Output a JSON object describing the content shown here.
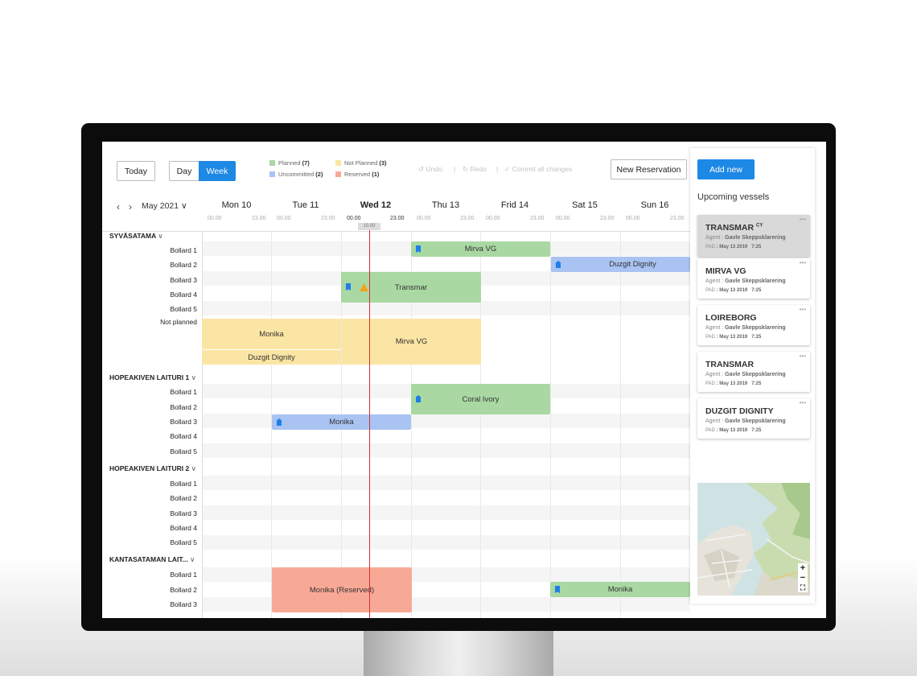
{
  "toolbar": {
    "today": "Today",
    "day": "Day",
    "week": "Week",
    "undo": "Undo",
    "redo": "Redo",
    "commit": "Commit all changes",
    "new_reservation": "New Reservation",
    "sep": "|"
  },
  "legend": [
    {
      "label": "Planned",
      "count": "(7)",
      "color": "#a9d8a3"
    },
    {
      "label": "Not Planned",
      "count": "(3)",
      "color": "#fbe5a4"
    },
    {
      "label": "Uncommitted",
      "count": "(2)",
      "color": "#a9c3f2"
    },
    {
      "label": "Reserved",
      "count": "(1)",
      "color": "#f8a996"
    }
  ],
  "calendar": {
    "month": "May 2021",
    "prev": "‹",
    "next": "›",
    "dropdown": "∨",
    "days": [
      "Mon 10",
      "Tue 11",
      "Wed 12",
      "Thu 13",
      "Frid 14",
      "Sat 15",
      "Sun 16"
    ],
    "tick_start": "00.00",
    "tick_end": "23.00",
    "now_time": "10.00"
  },
  "groups": [
    {
      "name": "SYVÄSATAMA",
      "chevron": "∨"
    },
    {
      "name": "HOPEAKIVEN LAITURI 1",
      "chevron": "∨"
    },
    {
      "name": "HOPEAKIVEN LAITURI 2",
      "chevron": "∨"
    },
    {
      "name": "KANTASATAMAN LAIT...",
      "chevron": "∨"
    }
  ],
  "bollards": [
    "Bollard 1",
    "Bollard 2",
    "Bollard 3",
    "Bollard 4",
    "Bollard 5"
  ],
  "not_planned": "Not planned",
  "bookings": {
    "b1": "Mirva VG",
    "b2": "Duzgit Dignity",
    "b3": "Transmar",
    "b4": "Monika",
    "b5": "Duzgit Dignity",
    "b6": "Mirva VG",
    "b7": "Coral Ivory",
    "b8": "Monika",
    "b9": "Monika (Reserved)",
    "b10": "Monika"
  },
  "sidebar": {
    "add_new": "Add new",
    "title": "Upcoming vessels",
    "vessels": [
      {
        "name": "TRANSMAR",
        "flag": "CY",
        "agent_label": "Agent :",
        "agent": "Gavle Skeppsklarering",
        "pad_label": "PAD",
        "pad": ": May 13 2019",
        "time": "7:25",
        "menu": "•••"
      },
      {
        "name": "MIRVA VG",
        "flag": "",
        "agent_label": "Agent :",
        "agent": "Gavle Skeppsklarering",
        "pad_label": "PAD",
        "pad": ": May 13 2019",
        "time": "7:25",
        "menu": "•••"
      },
      {
        "name": "LOIREBORG",
        "flag": "",
        "agent_label": "Agent :",
        "agent": "Gavle Skeppsklarering",
        "pad_label": "PAD",
        "pad": ": May 13 2019",
        "time": "7:25",
        "menu": "•••"
      },
      {
        "name": "TRANSMAR",
        "flag": "",
        "agent_label": "Agent :",
        "agent": "Gavle Skeppsklarering",
        "pad_label": "PAD",
        "pad": ": May 13 2019",
        "time": "7:25",
        "menu": "•••"
      },
      {
        "name": "DUZGIT DIGNITY",
        "flag": "",
        "agent_label": "Agent :",
        "agent": "Gavle Skeppsklarering",
        "pad_label": "PAD",
        "pad": ": May 13 2019",
        "time": "7:25",
        "menu": "•••"
      }
    ],
    "map": {
      "zoom_in": "+",
      "zoom_out": "−",
      "fullscreen": "⛶"
    }
  }
}
